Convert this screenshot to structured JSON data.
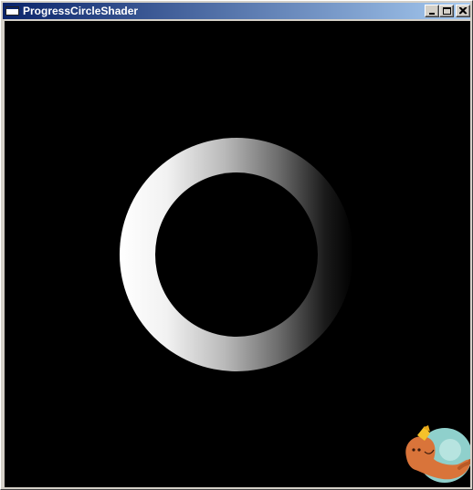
{
  "window": {
    "title": "ProgressCircleShader",
    "app_icon": "window-app-icon",
    "controls": {
      "minimize_icon": "minimize-icon",
      "maximize_icon": "maximize-icon",
      "close_icon": "close-icon"
    }
  },
  "canvas": {
    "background": "#000000",
    "ring": {
      "gradient_start_color": "#ffffff",
      "gradient_end_color": "#000000",
      "gradient_direction": "left-to-right"
    },
    "overlay_icon": "mascot-badge-icon"
  }
}
